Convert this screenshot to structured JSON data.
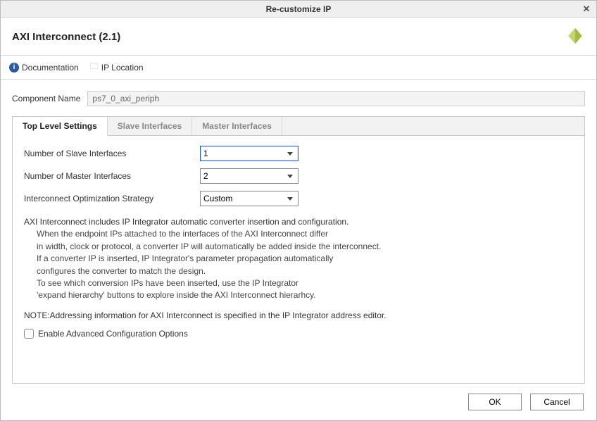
{
  "window": {
    "title": "Re-customize IP"
  },
  "header": {
    "title": "AXI Interconnect (2.1)"
  },
  "toolbar": {
    "documentation": "Documentation",
    "ip_location": "IP Location"
  },
  "component": {
    "label": "Component Name",
    "value": "ps7_0_axi_periph"
  },
  "tabs": [
    {
      "label": "Top Level Settings",
      "active": true
    },
    {
      "label": "Slave Interfaces",
      "active": false
    },
    {
      "label": "Master Interfaces",
      "active": false
    }
  ],
  "settings": {
    "slave": {
      "label": "Number of Slave Interfaces",
      "value": "1"
    },
    "master": {
      "label": "Number of Master Interfaces",
      "value": "2"
    },
    "strategy": {
      "label": "Interconnect Optimization Strategy",
      "value": "Custom"
    }
  },
  "desc": {
    "intro": "AXI Interconnect includes IP Integrator automatic converter insertion and configuration.",
    "lines": [
      "When the endpoint IPs attached to the interfaces of the AXI Interconnect differ",
      "in width, clock or protocol, a converter IP will automatically be added inside the interconnect.",
      "If a converter IP is inserted, IP Integrator's parameter propagation automatically",
      "configures the converter to match the design.",
      "To see which conversion IPs have been inserted, use the IP Integrator",
      "'expand hierarchy' buttons to explore inside the AXI Interconnect hierarhcy."
    ],
    "note": "NOTE:Addressing information for AXI Interconnect is specified in the IP Integrator address editor."
  },
  "advanced": {
    "label": "Enable Advanced Configuration Options",
    "checked": false
  },
  "buttons": {
    "ok": "OK",
    "cancel": "Cancel"
  }
}
